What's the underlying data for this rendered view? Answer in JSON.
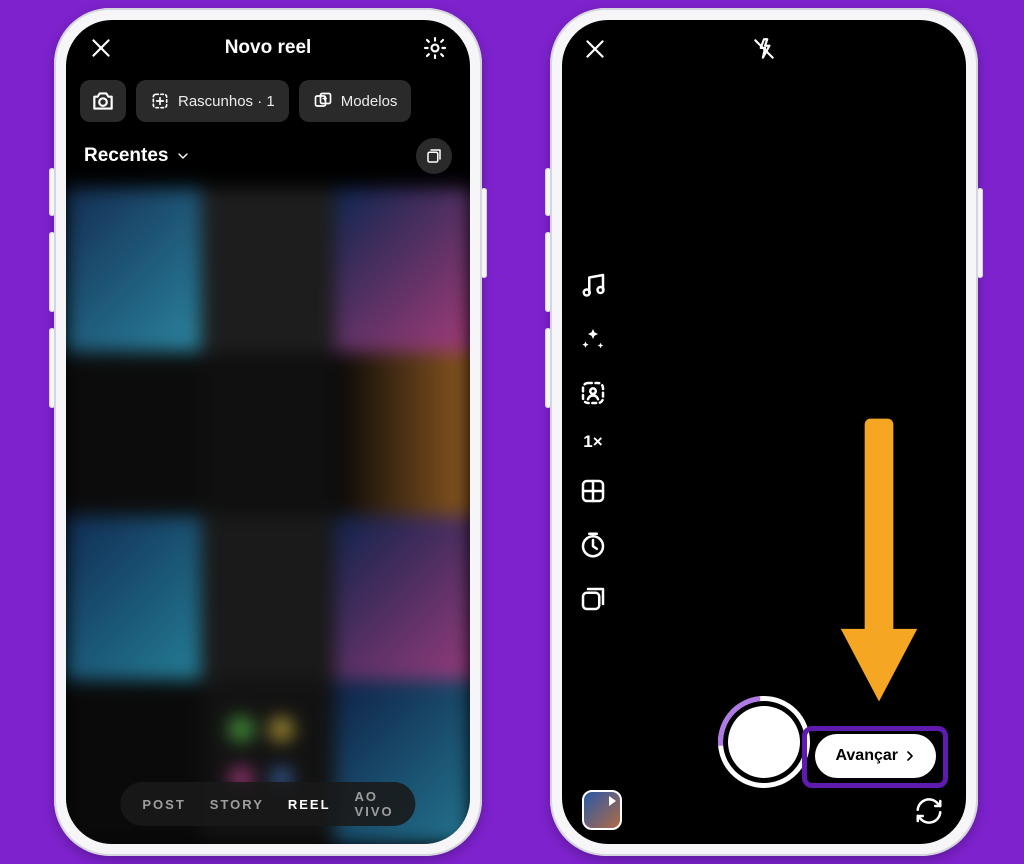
{
  "left": {
    "title": "Novo reel",
    "chips": {
      "drafts": "Rascunhos · 1",
      "templates": "Modelos"
    },
    "section_label": "Recentes",
    "modes": {
      "post": "POST",
      "story": "STORY",
      "reel": "REEL",
      "live": "AO VIVO",
      "active": "reel"
    }
  },
  "right": {
    "zoom_label": "1×",
    "next_label": "Avançar"
  },
  "annotation": "arrow pointing to Avançar button",
  "colors": {
    "background": "#7e22ce",
    "arrow": "#f5a623",
    "highlight_border": "#5f1ab0"
  }
}
